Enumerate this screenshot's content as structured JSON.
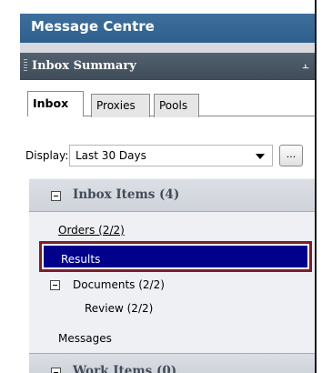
{
  "window": {
    "title": "Message Centre"
  },
  "pane": {
    "title": "Inbox Summary",
    "pin_glyph": "↑"
  },
  "tabs": [
    {
      "label": "Inbox",
      "active": true
    },
    {
      "label": "Proxies",
      "active": false
    },
    {
      "label": "Pools",
      "active": false
    }
  ],
  "display": {
    "label": "Display:",
    "selected": "Last 30 Days",
    "ellipsis_label": "..."
  },
  "inbox_group": {
    "title": "Inbox Items (4)",
    "items": {
      "orders": "Orders (2/2)",
      "results": "Results",
      "documents": "Documents (2/2)",
      "review": "Review (2/2)",
      "messages": "Messages"
    }
  },
  "next_group": {
    "title": "Work Items (0)"
  },
  "colors": {
    "title_bar": "#2f5f8d",
    "pane_header": "#4a5664",
    "selection": "#00008b",
    "highlight_border": "#7a1f2b",
    "group_title": "#434b58"
  }
}
